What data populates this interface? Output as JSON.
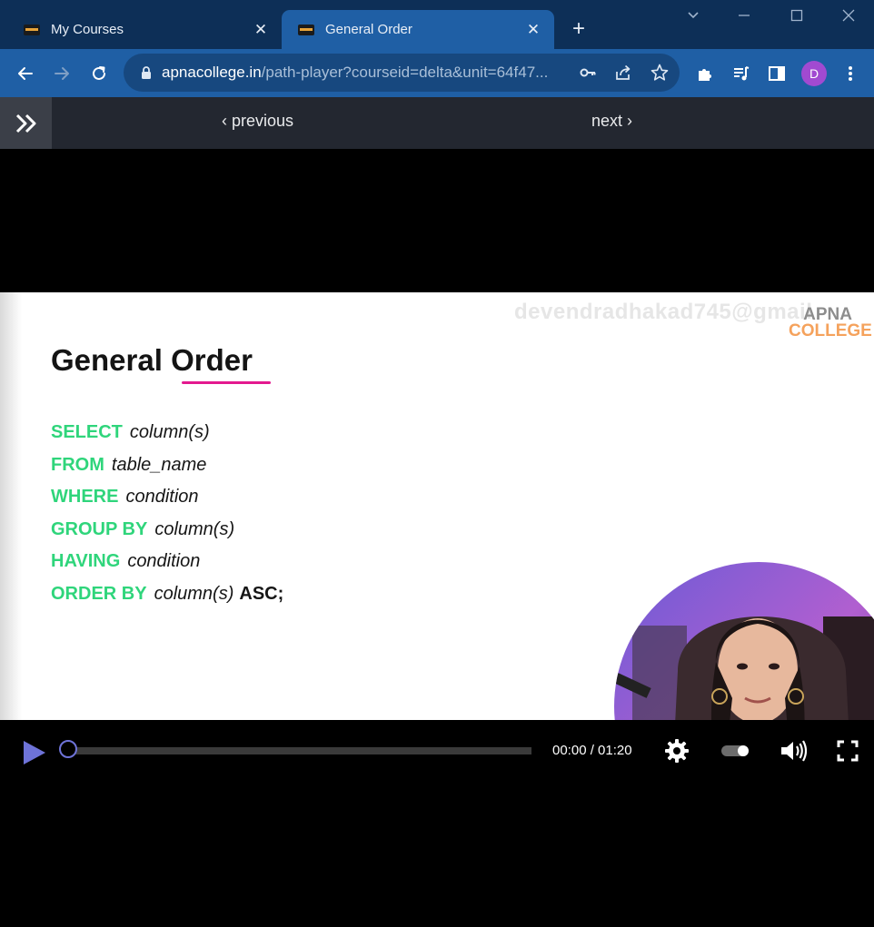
{
  "browser": {
    "tabs": [
      {
        "title": "My Courses",
        "active": false
      },
      {
        "title": "General Order",
        "active": true
      }
    ],
    "new_tab_icon": "plus-icon",
    "url_host": "apnacollege.in",
    "url_path": "/path-player?courseid=delta&unit=64f47...",
    "profile_initial": "D",
    "colors": {
      "tabstrip": "#0d2f57",
      "toolbar": "#1f5fa5",
      "omnibox": "#17487f",
      "avatar": "#a14ad1"
    }
  },
  "course_nav": {
    "previous_label": "previous",
    "next_label": "next"
  },
  "slide": {
    "title": "General Order",
    "watermark": "devendradhakad745@gmail",
    "logo_top": "APNA",
    "logo_bottom": "COLLEGE",
    "lines": [
      {
        "keyword": "SELECT",
        "arg": "column(s)",
        "suffix": ""
      },
      {
        "keyword": "FROM",
        "arg": "table_name",
        "suffix": ""
      },
      {
        "keyword": "WHERE",
        "arg": "condition",
        "suffix": ""
      },
      {
        "keyword": "GROUP BY",
        "arg": "column(s)",
        "suffix": ""
      },
      {
        "keyword": "HAVING",
        "arg": "condition",
        "suffix": ""
      },
      {
        "keyword": "ORDER BY",
        "arg": "column(s)",
        "suffix": "ASC;"
      }
    ],
    "colors": {
      "keyword": "#2fd57b",
      "underline": "#e3198f"
    }
  },
  "player": {
    "time_display": "00:00 / 01:20",
    "progress": 0,
    "accent": "#6e73d8"
  }
}
